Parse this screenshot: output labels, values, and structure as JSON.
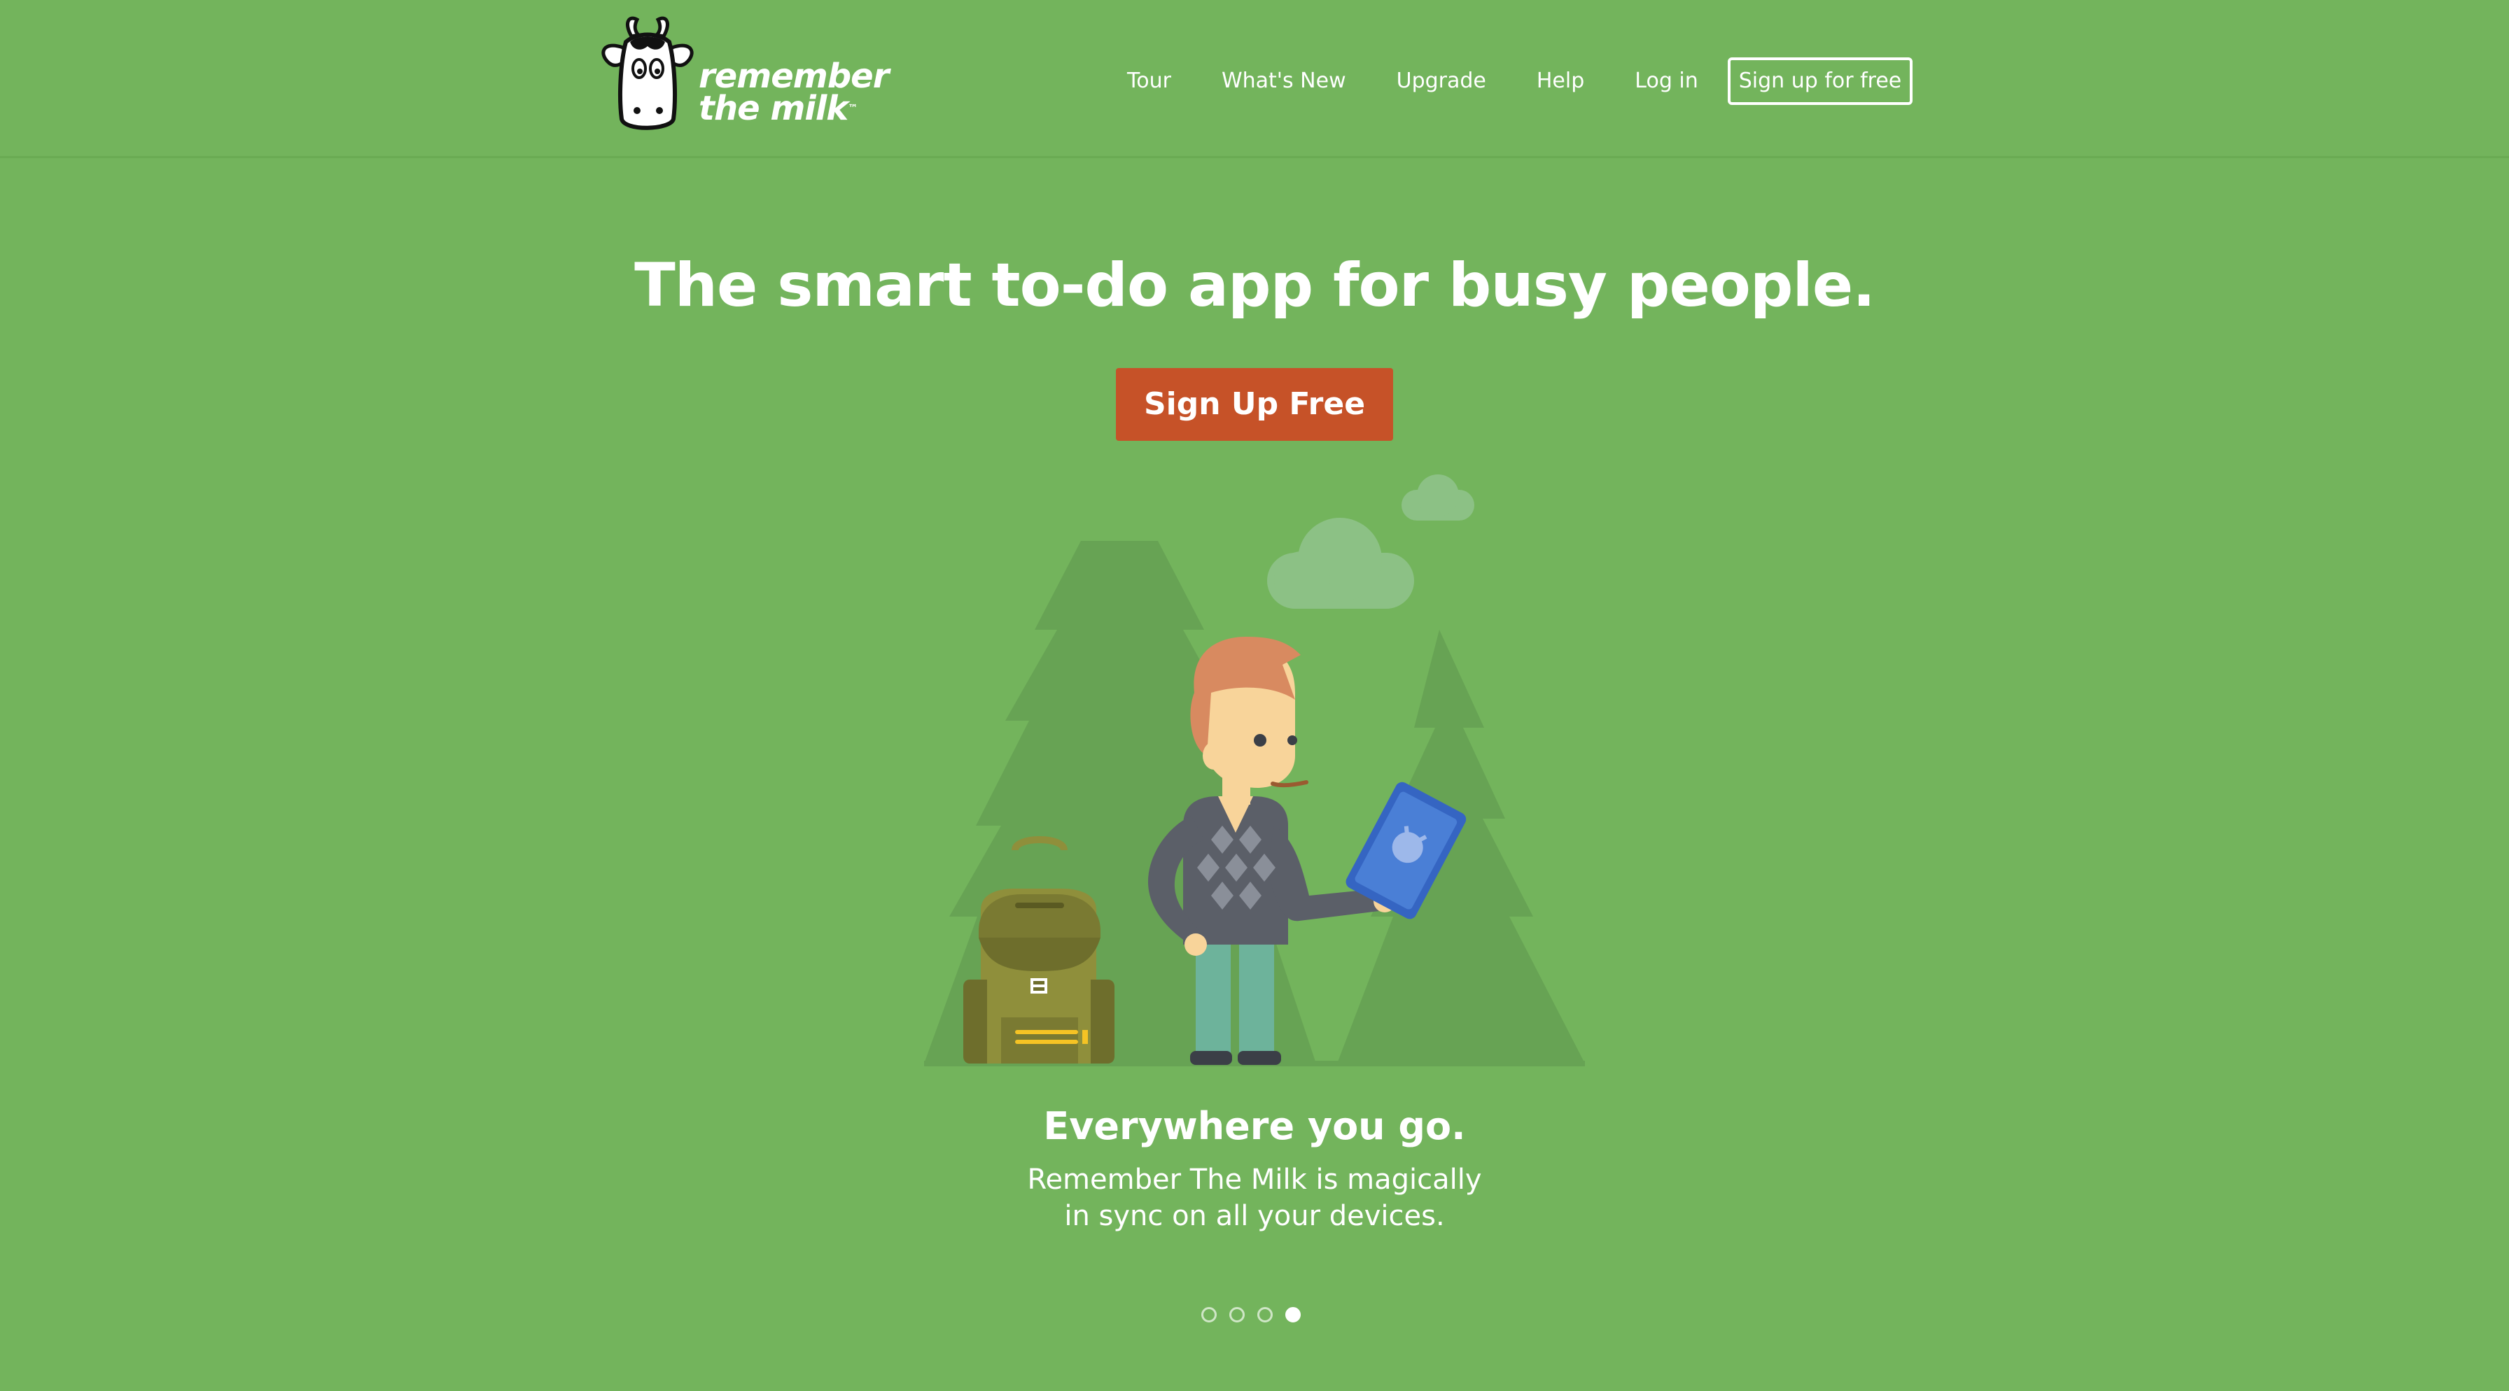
{
  "brand": {
    "logo_line1": "remember",
    "logo_line2": "the milk",
    "trademark": "™"
  },
  "nav": {
    "items": [
      {
        "label": "Tour"
      },
      {
        "label": "What's New"
      },
      {
        "label": "Upgrade"
      },
      {
        "label": "Help"
      },
      {
        "label": "Log in"
      }
    ],
    "signup_label": "Sign up for free"
  },
  "hero": {
    "headline": "The smart to-do app for busy people.",
    "cta_label": "Sign Up Free"
  },
  "slide": {
    "title": "Everywhere you go.",
    "body_line1": "Remember The Milk is magically",
    "body_line2": "in sync on all your devices."
  },
  "carousel": {
    "total": 4,
    "active_index": 3
  },
  "colors": {
    "background": "#73b45c",
    "cta": "#c65228",
    "tree": "#67a354",
    "cloud": "#8cc185"
  },
  "icons": {
    "logo": "cow-logo-icon",
    "illustration": "person-with-tablet-illustration"
  }
}
